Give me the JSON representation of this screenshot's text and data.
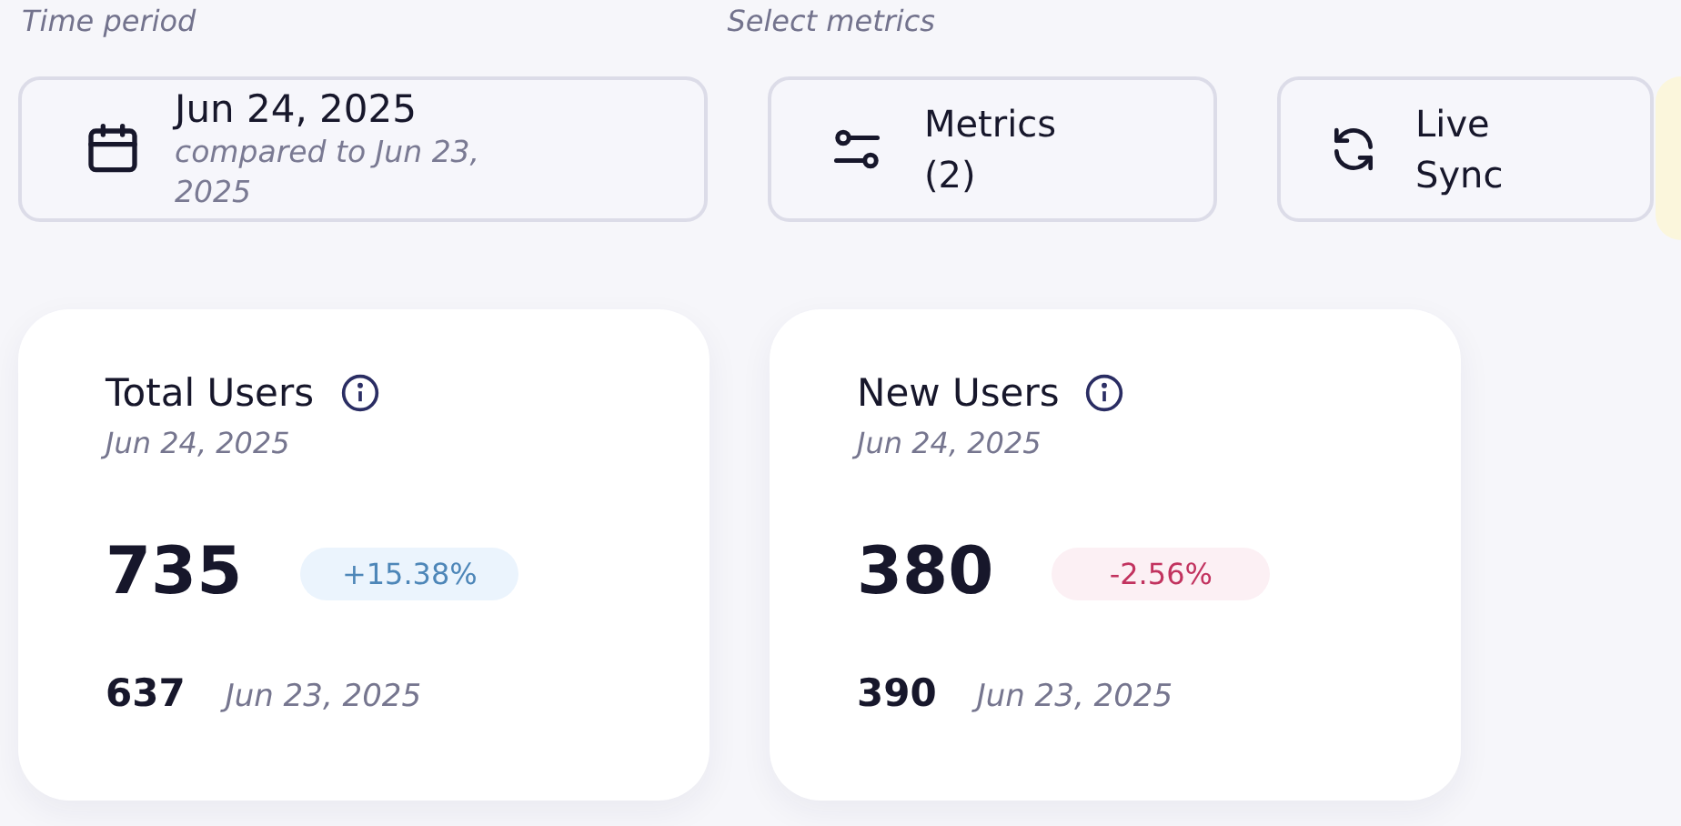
{
  "filters": [
    {
      "label": "Time period"
    },
    {
      "label": "Select metrics"
    }
  ],
  "date_button": {
    "date": "Jun 24, 2025",
    "comparison": "compared to Jun 23, 2025"
  },
  "metrics_button": {
    "label": "Metrics (2)"
  },
  "sync_button": {
    "label": "Live Sync"
  },
  "cards": [
    {
      "title": "Total Users",
      "date": "Jun 24, 2025",
      "value": "735",
      "change": "+15.38%",
      "positive": true,
      "previous_value": "637",
      "previous_date": "Jun 23, 2025"
    },
    {
      "title": "New Users",
      "date": "Jun 24, 2025",
      "value": "380",
      "change": "-2.56%",
      "positive": false,
      "previous_value": "390",
      "previous_date": "Jun 23, 2025"
    }
  ]
}
